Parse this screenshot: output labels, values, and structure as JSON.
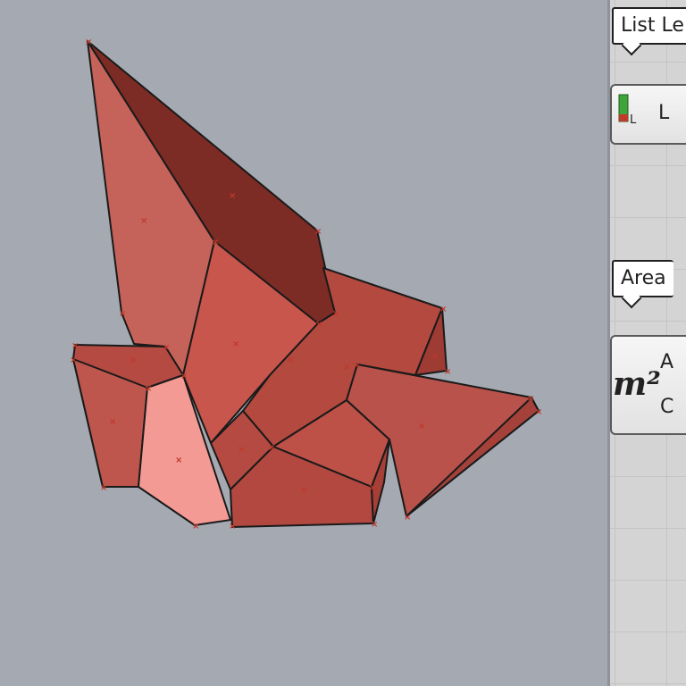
{
  "viewport": {
    "name": "rhino-viewport",
    "background_color": "#a4a9b2",
    "object_color": "#c05a53",
    "object_edge_color": "#1a1a1a",
    "control_point_color": "#c0392b"
  },
  "canvas": {
    "tooltip_list_length": "List Le",
    "list_length_component": {
      "input_label": "L",
      "icon": "list-length-icon"
    },
    "tooltip_area": "Area",
    "area_component": {
      "icon_text": "m²",
      "output_area": "A",
      "output_centroid": "C"
    }
  }
}
